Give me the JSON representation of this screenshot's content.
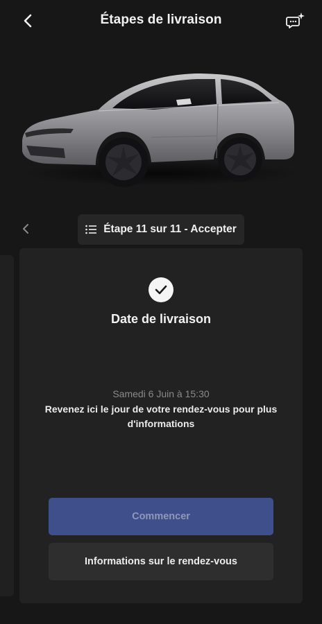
{
  "header": {
    "title": "Étapes de livraison",
    "back_icon": "chevron-left-icon",
    "chat_icon": "chat-sparkle-icon"
  },
  "vehicle": {
    "image": "grey Tesla Model Y side-front view"
  },
  "stepper": {
    "label": "Étape 11 sur 11 - Accepter",
    "list_icon": "list-icon",
    "prev_icon": "chevron-left-icon"
  },
  "card": {
    "status_icon": "check-circle-icon",
    "title": "Date de livraison",
    "date": "Samedi 6 Juin à 15:30",
    "description": "Revenez ici le jour de votre rendez-vous pour plus d'informations",
    "primary_button": "Commencer",
    "secondary_button": "Informations sur le rendez-vous"
  },
  "colors": {
    "background": "#171717",
    "card": "#222222",
    "primary_button": "#3e4f8c",
    "secondary_button": "#2e2e2e"
  }
}
